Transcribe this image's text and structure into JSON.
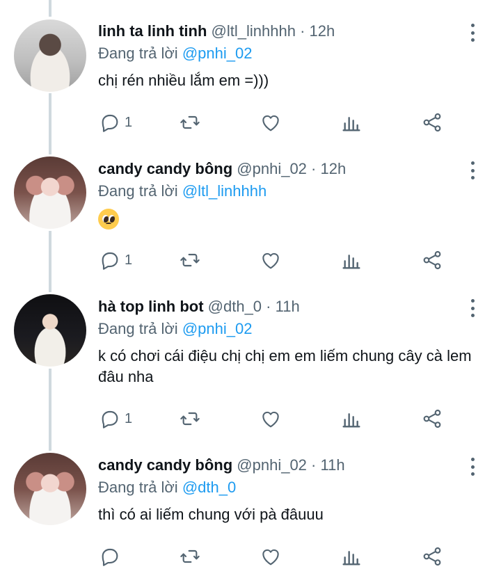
{
  "reply_prefix": "Đang trả lời",
  "tweets": [
    {
      "name": "linh ta linh tinh",
      "handle": "@ltl_linhhhh",
      "time": "12h",
      "reply_to": "@pnhi_02",
      "text": "chị rén nhiều lắm em =)))",
      "reply_count": "1"
    },
    {
      "name": "candy candy bông",
      "handle": "@pnhi_02",
      "time": "12h",
      "reply_to": "@ltl_linhhhh",
      "text": "",
      "emoji": "pleading-face-emoji",
      "reply_count": "1"
    },
    {
      "name": "hà top linh bot",
      "handle": "@dth_0",
      "time": "11h",
      "reply_to": "@pnhi_02",
      "text": "k có chơi cái điệu chị chị em em liếm chung cây cà lem đâu nha",
      "reply_count": "1"
    },
    {
      "name": "candy candy bông",
      "handle": "@pnhi_02",
      "time": "11h",
      "reply_to": "@dth_0",
      "text": "thì có ai liếm chung với pà đâuuu",
      "reply_count": ""
    }
  ],
  "icons": {
    "reply": "reply-icon",
    "retweet": "retweet-icon",
    "like": "heart-icon",
    "views": "analytics-icon",
    "share": "share-icon",
    "more": "more-vertical-icon"
  },
  "colors": {
    "mention": "#1d9bf0",
    "secondary_text": "#536471",
    "thread_line": "#cfd9de"
  }
}
